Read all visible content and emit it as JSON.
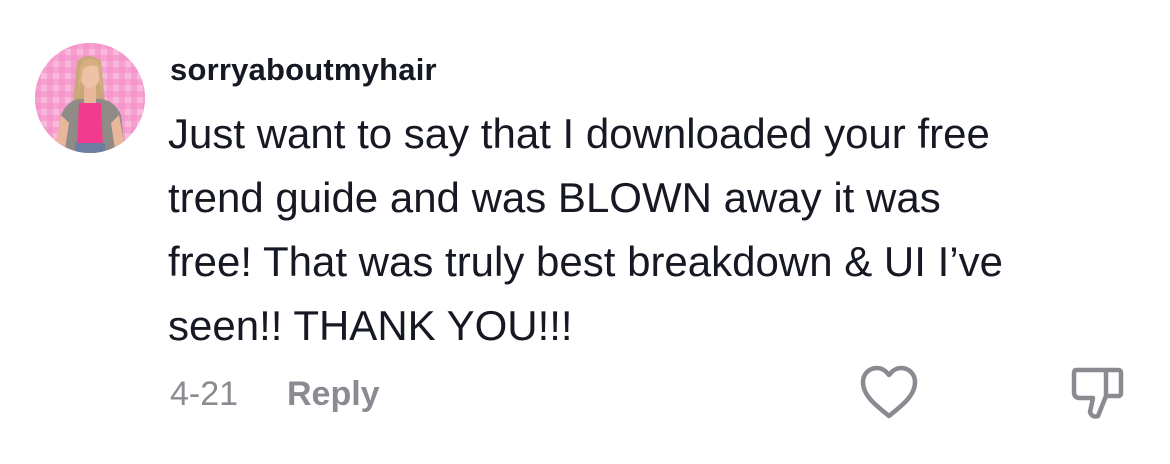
{
  "comment": {
    "username": "sorryaboutmyhair",
    "text_lines": [
      "Just want to say that I downloaded your free",
      "trend guide and was BLOWN away it was",
      "free! That was truly best breakdown & UI I’ve",
      "seen!! THANK YOU!!!"
    ],
    "date": "4-21",
    "reply_label": "Reply"
  },
  "icons": {
    "avatar": "profile-photo",
    "like": "heart-outline-icon",
    "dislike": "thumbs-down-outline-icon"
  },
  "colors": {
    "text": "#161823",
    "muted": "#8a8b91",
    "avatar_bg": "#f6a9d2"
  }
}
